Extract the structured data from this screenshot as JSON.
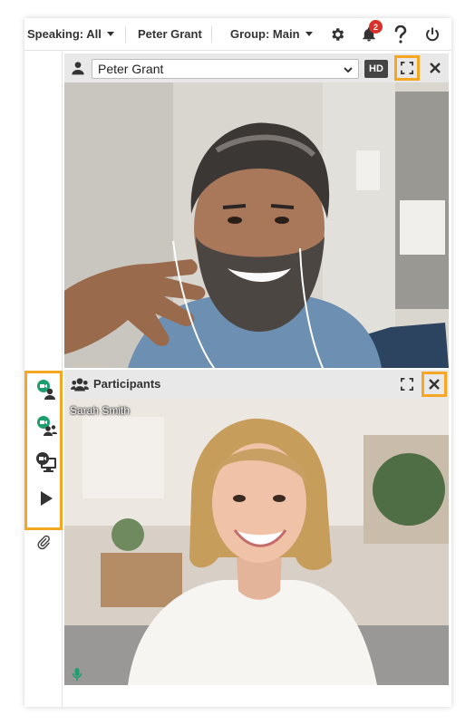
{
  "topbar": {
    "speaking_label": "Speaking: All",
    "user_name": "Peter Grant",
    "group_label": "Group: Main",
    "notification_count": "2",
    "icons": [
      "gear-icon",
      "bell-icon",
      "help-icon",
      "power-icon"
    ]
  },
  "sidebar": {
    "buttons": [
      "video-user-icon",
      "video-group-icon",
      "screen-share-icon",
      "play-icon"
    ],
    "attachment": "paperclip-icon"
  },
  "video_panel": {
    "selected_participant": "Peter Grant",
    "hd_label": "HD",
    "icons": [
      "user-icon",
      "fullscreen-icon",
      "close-icon"
    ]
  },
  "participants_panel": {
    "title": "Participants",
    "participant_name": "Sarah Smith",
    "icons": [
      "group-icon",
      "fullscreen-icon",
      "close-icon",
      "microphone-icon"
    ]
  },
  "colors": {
    "highlight": "#f5a623",
    "accent": "#1e9e6e",
    "badge": "#d9302a"
  }
}
